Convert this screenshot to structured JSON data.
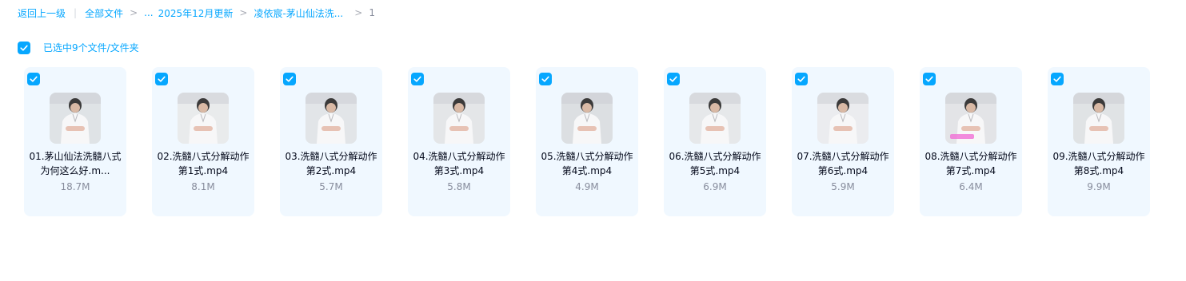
{
  "breadcrumb": {
    "back": "返回上一级",
    "all_files": "全部文件",
    "ellipsis": "...",
    "folder1": "2025年12月更新",
    "folder2": "凌依宸-茅山仙法洗...",
    "current": "1"
  },
  "selection": {
    "label": "已选中9个文件/文件夹",
    "checked": true
  },
  "files": [
    {
      "name": "01.茅山仙法洗髓八式为何这么好.m...",
      "size": "18.7M",
      "checked": true,
      "icon": "video-thumbnail"
    },
    {
      "name": "02.洗髓八式分解动作第1式.mp4",
      "size": "8.1M",
      "checked": true,
      "icon": "video-thumbnail"
    },
    {
      "name": "03.洗髓八式分解动作第2式.mp4",
      "size": "5.7M",
      "checked": true,
      "icon": "video-thumbnail"
    },
    {
      "name": "04.洗髓八式分解动作第3式.mp4",
      "size": "5.8M",
      "checked": true,
      "icon": "video-thumbnail"
    },
    {
      "name": "05.洗髓八式分解动作第4式.mp4",
      "size": "4.9M",
      "checked": true,
      "icon": "video-thumbnail"
    },
    {
      "name": "06.洗髓八式分解动作第5式.mp4",
      "size": "6.9M",
      "checked": true,
      "icon": "video-thumbnail"
    },
    {
      "name": "07.洗髓八式分解动作第6式.mp4",
      "size": "5.9M",
      "checked": true,
      "icon": "video-thumbnail"
    },
    {
      "name": "08.洗髓八式分解动作第7式.mp4",
      "size": "6.4M",
      "checked": true,
      "icon": "video-thumbnail"
    },
    {
      "name": "09.洗髓八式分解动作第8式.mp4",
      "size": "9.9M",
      "checked": true,
      "icon": "video-thumbnail"
    }
  ],
  "colors": {
    "accent": "#06a7ff",
    "card_bg": "#f0f8ff",
    "text": "#03081a",
    "muted": "#878c9c"
  }
}
